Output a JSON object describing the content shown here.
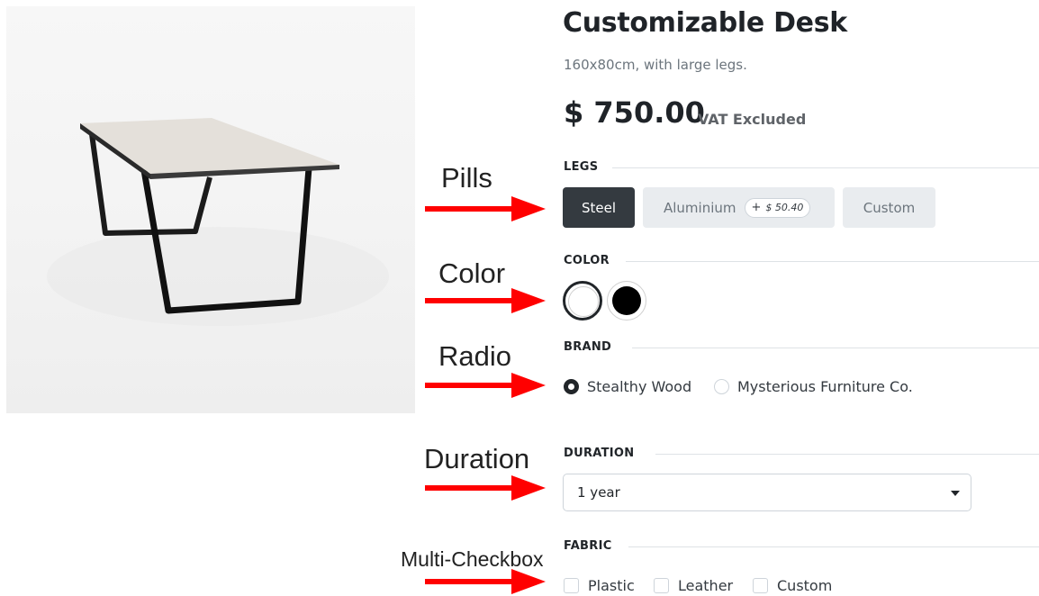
{
  "product": {
    "title": "Customizable Desk",
    "subtitle": "160x80cm, with large legs.",
    "price": "$ 750.00",
    "price_note": "VAT Excluded",
    "image_alt": "desk-photo"
  },
  "legs": {
    "label": "LEGS",
    "options": [
      {
        "label": "Steel",
        "selected": true
      },
      {
        "label": "Aluminium",
        "extra": "$ 50.40",
        "extra_prefix": "+",
        "selected": false
      },
      {
        "label": "Custom",
        "selected": false
      }
    ]
  },
  "color": {
    "label": "COLOR",
    "options": [
      {
        "name": "white",
        "hex": "#ffffff",
        "selected": true
      },
      {
        "name": "black",
        "hex": "#000000",
        "selected": false
      }
    ]
  },
  "brand": {
    "label": "BRAND",
    "options": [
      {
        "label": "Stealthy Wood",
        "selected": true
      },
      {
        "label": "Mysterious Furniture Co.",
        "selected": false
      }
    ]
  },
  "duration": {
    "label": "DURATION",
    "selected": "1 year"
  },
  "fabric": {
    "label": "FABRIC",
    "options": [
      {
        "label": "Plastic",
        "checked": false
      },
      {
        "label": "Leather",
        "checked": false
      },
      {
        "label": "Custom",
        "checked": false
      }
    ]
  },
  "annotations": {
    "pills": "Pills",
    "color": "Color",
    "radio": "Radio",
    "duration": "Duration",
    "multi_checkbox": "Multi-Checkbox",
    "arrow_color": "#ff0000"
  },
  "icons": {
    "select_caret": "caret-down-icon",
    "plus": "plus-icon"
  }
}
